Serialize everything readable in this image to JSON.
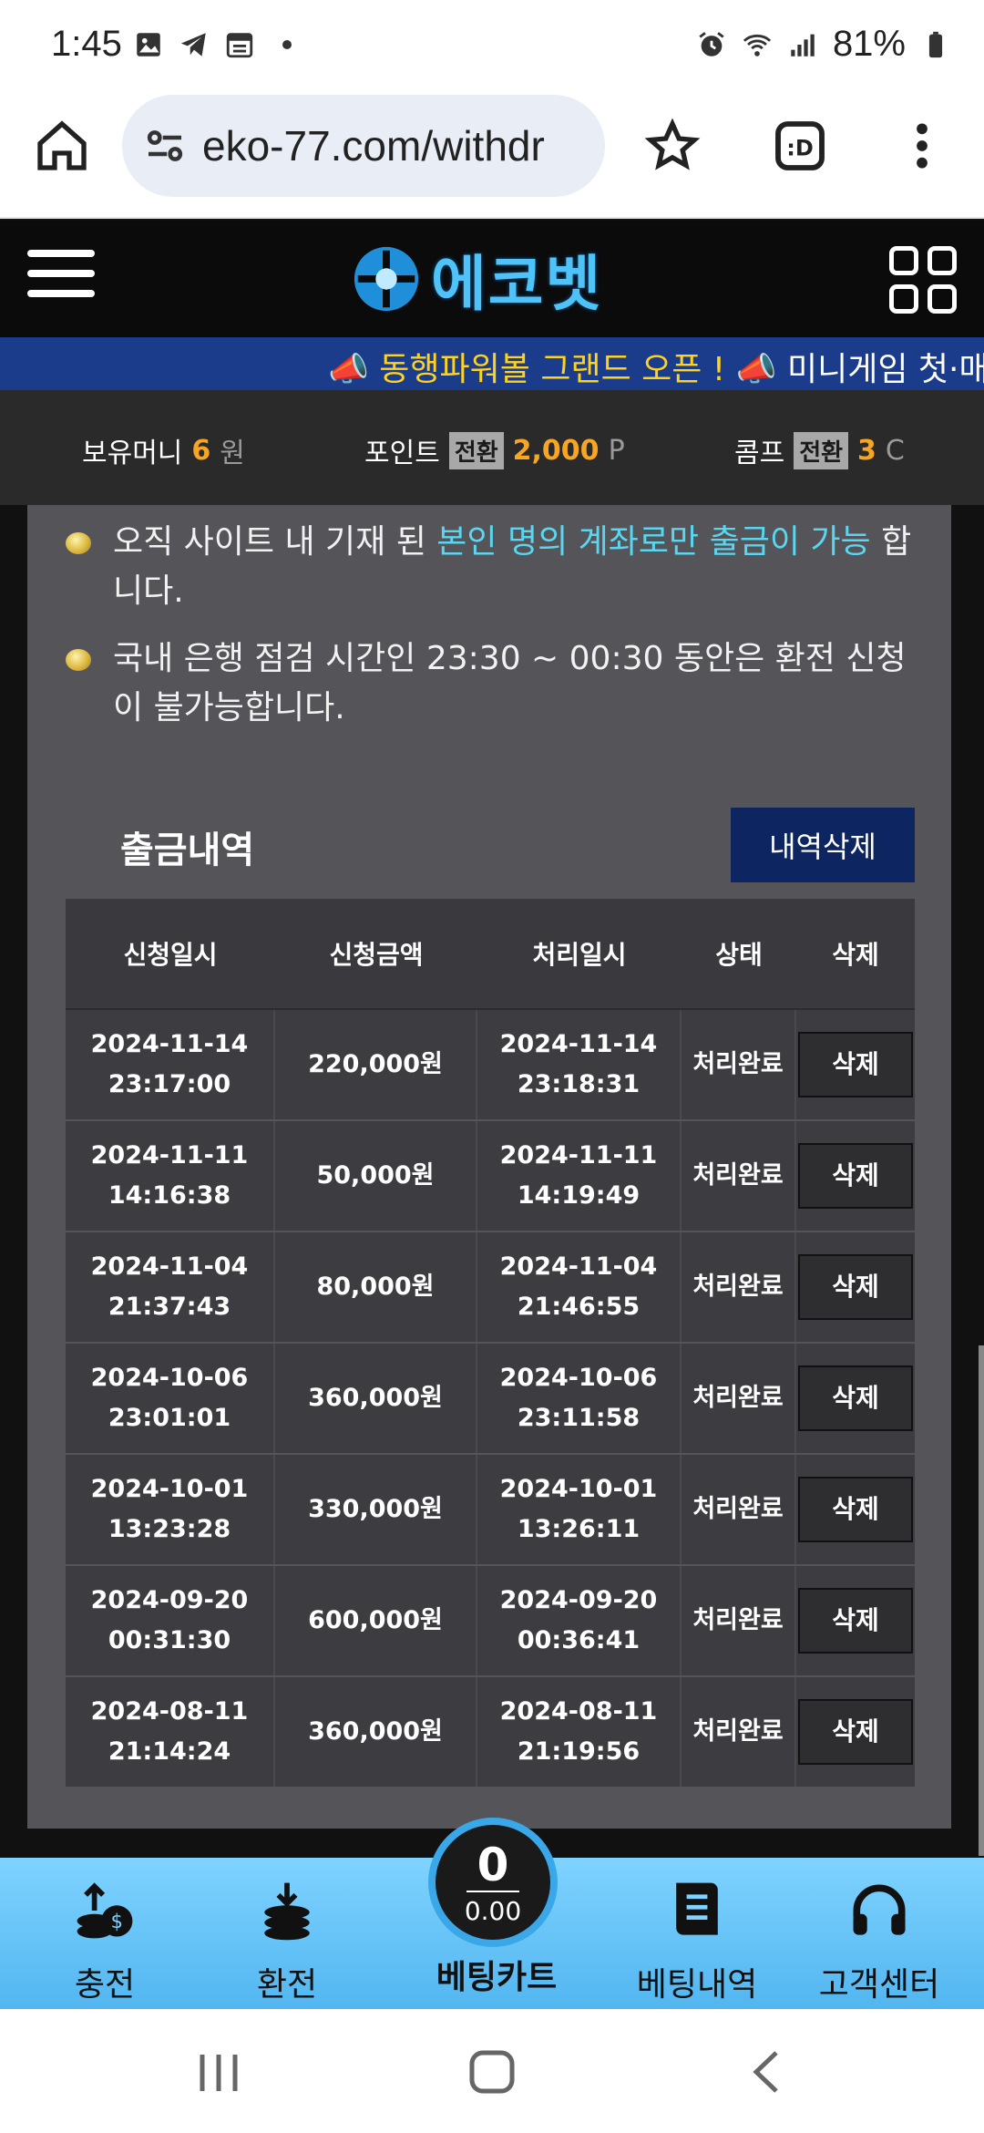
{
  "status_bar": {
    "time": "1:45",
    "battery": "81%",
    "left_icons": [
      "gallery-icon",
      "telegram-icon",
      "calendar-icon",
      "dot-icon"
    ],
    "right_icons": [
      "alarm-icon",
      "wifi-icon",
      "signal-icon",
      "battery-icon"
    ]
  },
  "browser": {
    "url": "eko-77.com/withdr"
  },
  "site": {
    "logo_text": "에코벳",
    "accent_color": "#4fc3f7"
  },
  "ticker": {
    "item1": "동행파워볼 그랜드 오픈 !",
    "item2": "미니게임 첫·매충"
  },
  "money_bar": {
    "money_label": "보유머니",
    "money_value": "6",
    "money_unit": "원",
    "point_label": "포인트",
    "point_chip": "전환",
    "point_value": "2,000",
    "point_unit": "P",
    "comp_label": "콤프",
    "comp_chip": "전환",
    "comp_value": "3",
    "comp_unit": "C"
  },
  "notices": {
    "n1_a": "오직 사이트 내 기재 된 ",
    "n1_link": "본인 명의 계좌로만 출금이 가능",
    "n1_b": " 합니다.",
    "n2": "국내 은행 점검 시간인 23:30 ~ 00:30 동안은 환전 신청이 불가능합니다."
  },
  "history": {
    "title": "출금내역",
    "delete_all_label": "내역삭제",
    "columns": [
      "신청일시",
      "신청금액",
      "처리일시",
      "상태",
      "삭제"
    ],
    "rows": [
      {
        "req_date": "2024-11-14",
        "req_time": "23:17:00",
        "amount": "220,000원",
        "proc_date": "2024-11-14",
        "proc_time": "23:18:31",
        "status": "처리완료",
        "delete": "삭제"
      },
      {
        "req_date": "2024-11-11",
        "req_time": "14:16:38",
        "amount": "50,000원",
        "proc_date": "2024-11-11",
        "proc_time": "14:19:49",
        "status": "처리완료",
        "delete": "삭제"
      },
      {
        "req_date": "2024-11-04",
        "req_time": "21:37:43",
        "amount": "80,000원",
        "proc_date": "2024-11-04",
        "proc_time": "21:46:55",
        "status": "처리완료",
        "delete": "삭제"
      },
      {
        "req_date": "2024-10-06",
        "req_time": "23:01:01",
        "amount": "360,000원",
        "proc_date": "2024-10-06",
        "proc_time": "23:11:58",
        "status": "처리완료",
        "delete": "삭제"
      },
      {
        "req_date": "2024-10-01",
        "req_time": "13:23:28",
        "amount": "330,000원",
        "proc_date": "2024-10-01",
        "proc_time": "13:26:11",
        "status": "처리완료",
        "delete": "삭제"
      },
      {
        "req_date": "2024-09-20",
        "req_time": "00:31:30",
        "amount": "600,000원",
        "proc_date": "2024-09-20",
        "proc_time": "00:36:41",
        "status": "처리완료",
        "delete": "삭제"
      },
      {
        "req_date": "2024-08-11",
        "req_time": "21:14:24",
        "amount": "360,000원",
        "proc_date": "2024-08-11",
        "proc_time": "21:19:56",
        "status": "처리완료",
        "delete": "삭제"
      }
    ]
  },
  "bottom_nav": {
    "deposit": "충전",
    "withdraw": "환전",
    "betcart_label": "베팅카트",
    "betcart_count": "0",
    "betcart_amount": "0.00",
    "bet_history": "베팅내역",
    "support": "고객센터"
  }
}
